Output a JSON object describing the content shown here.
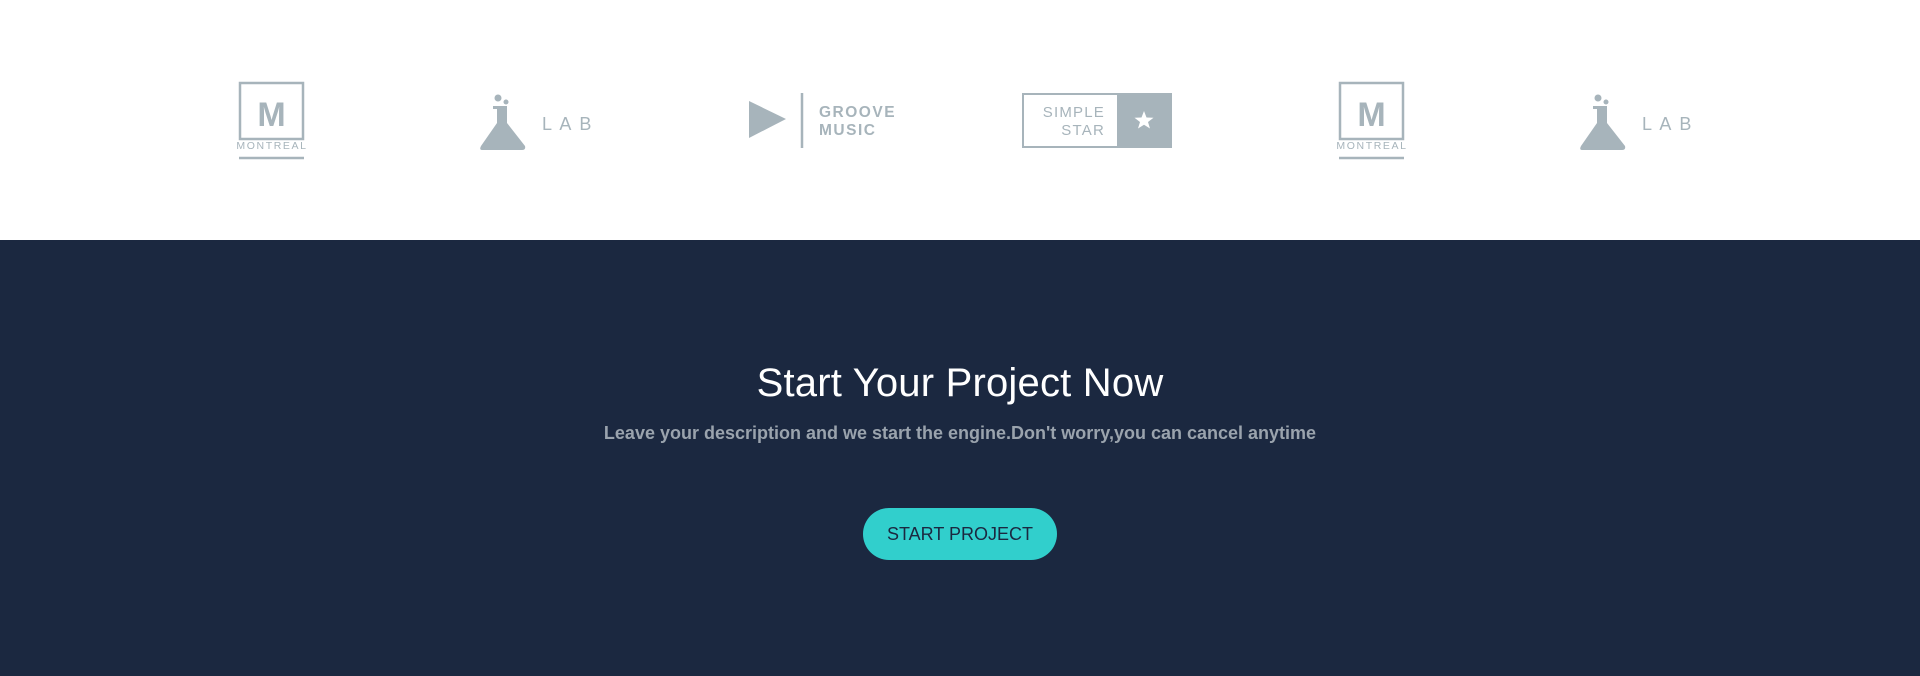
{
  "logos": [
    {
      "id": "montreal-1",
      "icon": "montreal-logo",
      "letter": "M",
      "text": "MONTREAL"
    },
    {
      "id": "lab-1",
      "icon": "flask-icon",
      "text": "L A B"
    },
    {
      "id": "groove-music",
      "icon": "play-icon",
      "line1": "GROOVE",
      "line2": "MUSIC"
    },
    {
      "id": "simple-star",
      "icon": "star-icon",
      "line1": "SIMPLE",
      "line2": "STAR"
    },
    {
      "id": "montreal-2",
      "icon": "montreal-logo",
      "letter": "M",
      "text": "MONTREAL"
    },
    {
      "id": "lab-2",
      "icon": "flask-icon",
      "text": "L A B"
    }
  ],
  "cta": {
    "title": "Start Your Project Now",
    "subtitle": "Leave your description and we start the engine.Don't worry,you can cancel anytime",
    "button_label": "START PROJECT"
  },
  "colors": {
    "logo_gray": "#a7b4bb",
    "cta_background": "#1b2840",
    "button_accent": "#31cfcc",
    "subtitle_gray": "#9aa3ad"
  }
}
